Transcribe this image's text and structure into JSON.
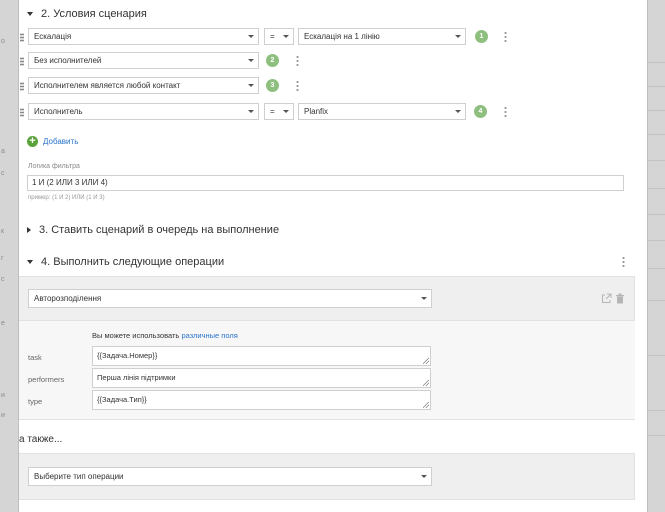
{
  "background": {
    "left_glyphs": [
      "о",
      "а",
      "с",
      "к",
      "г",
      "с",
      "е",
      "и",
      "и"
    ]
  },
  "section2": {
    "title": "2. Условия сценария",
    "conditions": [
      {
        "field": "Ескалація",
        "operator": "=",
        "value": "Ескалація на 1 лінію",
        "number": "1"
      },
      {
        "field": "Без исполнителей",
        "operator": "",
        "value": "",
        "number": "2"
      },
      {
        "field": "Исполнителем является любой контакт",
        "operator": "",
        "value": "",
        "number": "3"
      },
      {
        "field": "Исполнитель",
        "operator": "=",
        "value": "Planfix",
        "number": "4"
      }
    ],
    "add_label": "Добавить",
    "filter_logic_label": "Логика фильтра",
    "filter_logic_value": "1 И (2 ИЛИ 3 ИЛИ 4)",
    "filter_logic_hint": "пример: (1 И 2) ИЛИ (1 И 3)"
  },
  "section3": {
    "title": "3. Ставить сценарий в очередь на выполнение"
  },
  "section4": {
    "title": "4. Выполнить следующие операции",
    "operation_select": "Авторозподілення",
    "fields_hint_prefix": "Вы можете использовать",
    "fields_hint_link": "различные поля",
    "params": [
      {
        "name": "task",
        "value": "{{Задача.Номер}}"
      },
      {
        "name": "performers",
        "value": "Перша лінія підтримки"
      },
      {
        "name": "type",
        "value": "{{Задача.Тип}}"
      }
    ],
    "also_label": "а также...",
    "operation_type_placeholder": "Выберите тип операции"
  },
  "colors": {
    "accent": "#2a74c9",
    "badge": "#8fbf7f",
    "add": "#5aa23a"
  }
}
